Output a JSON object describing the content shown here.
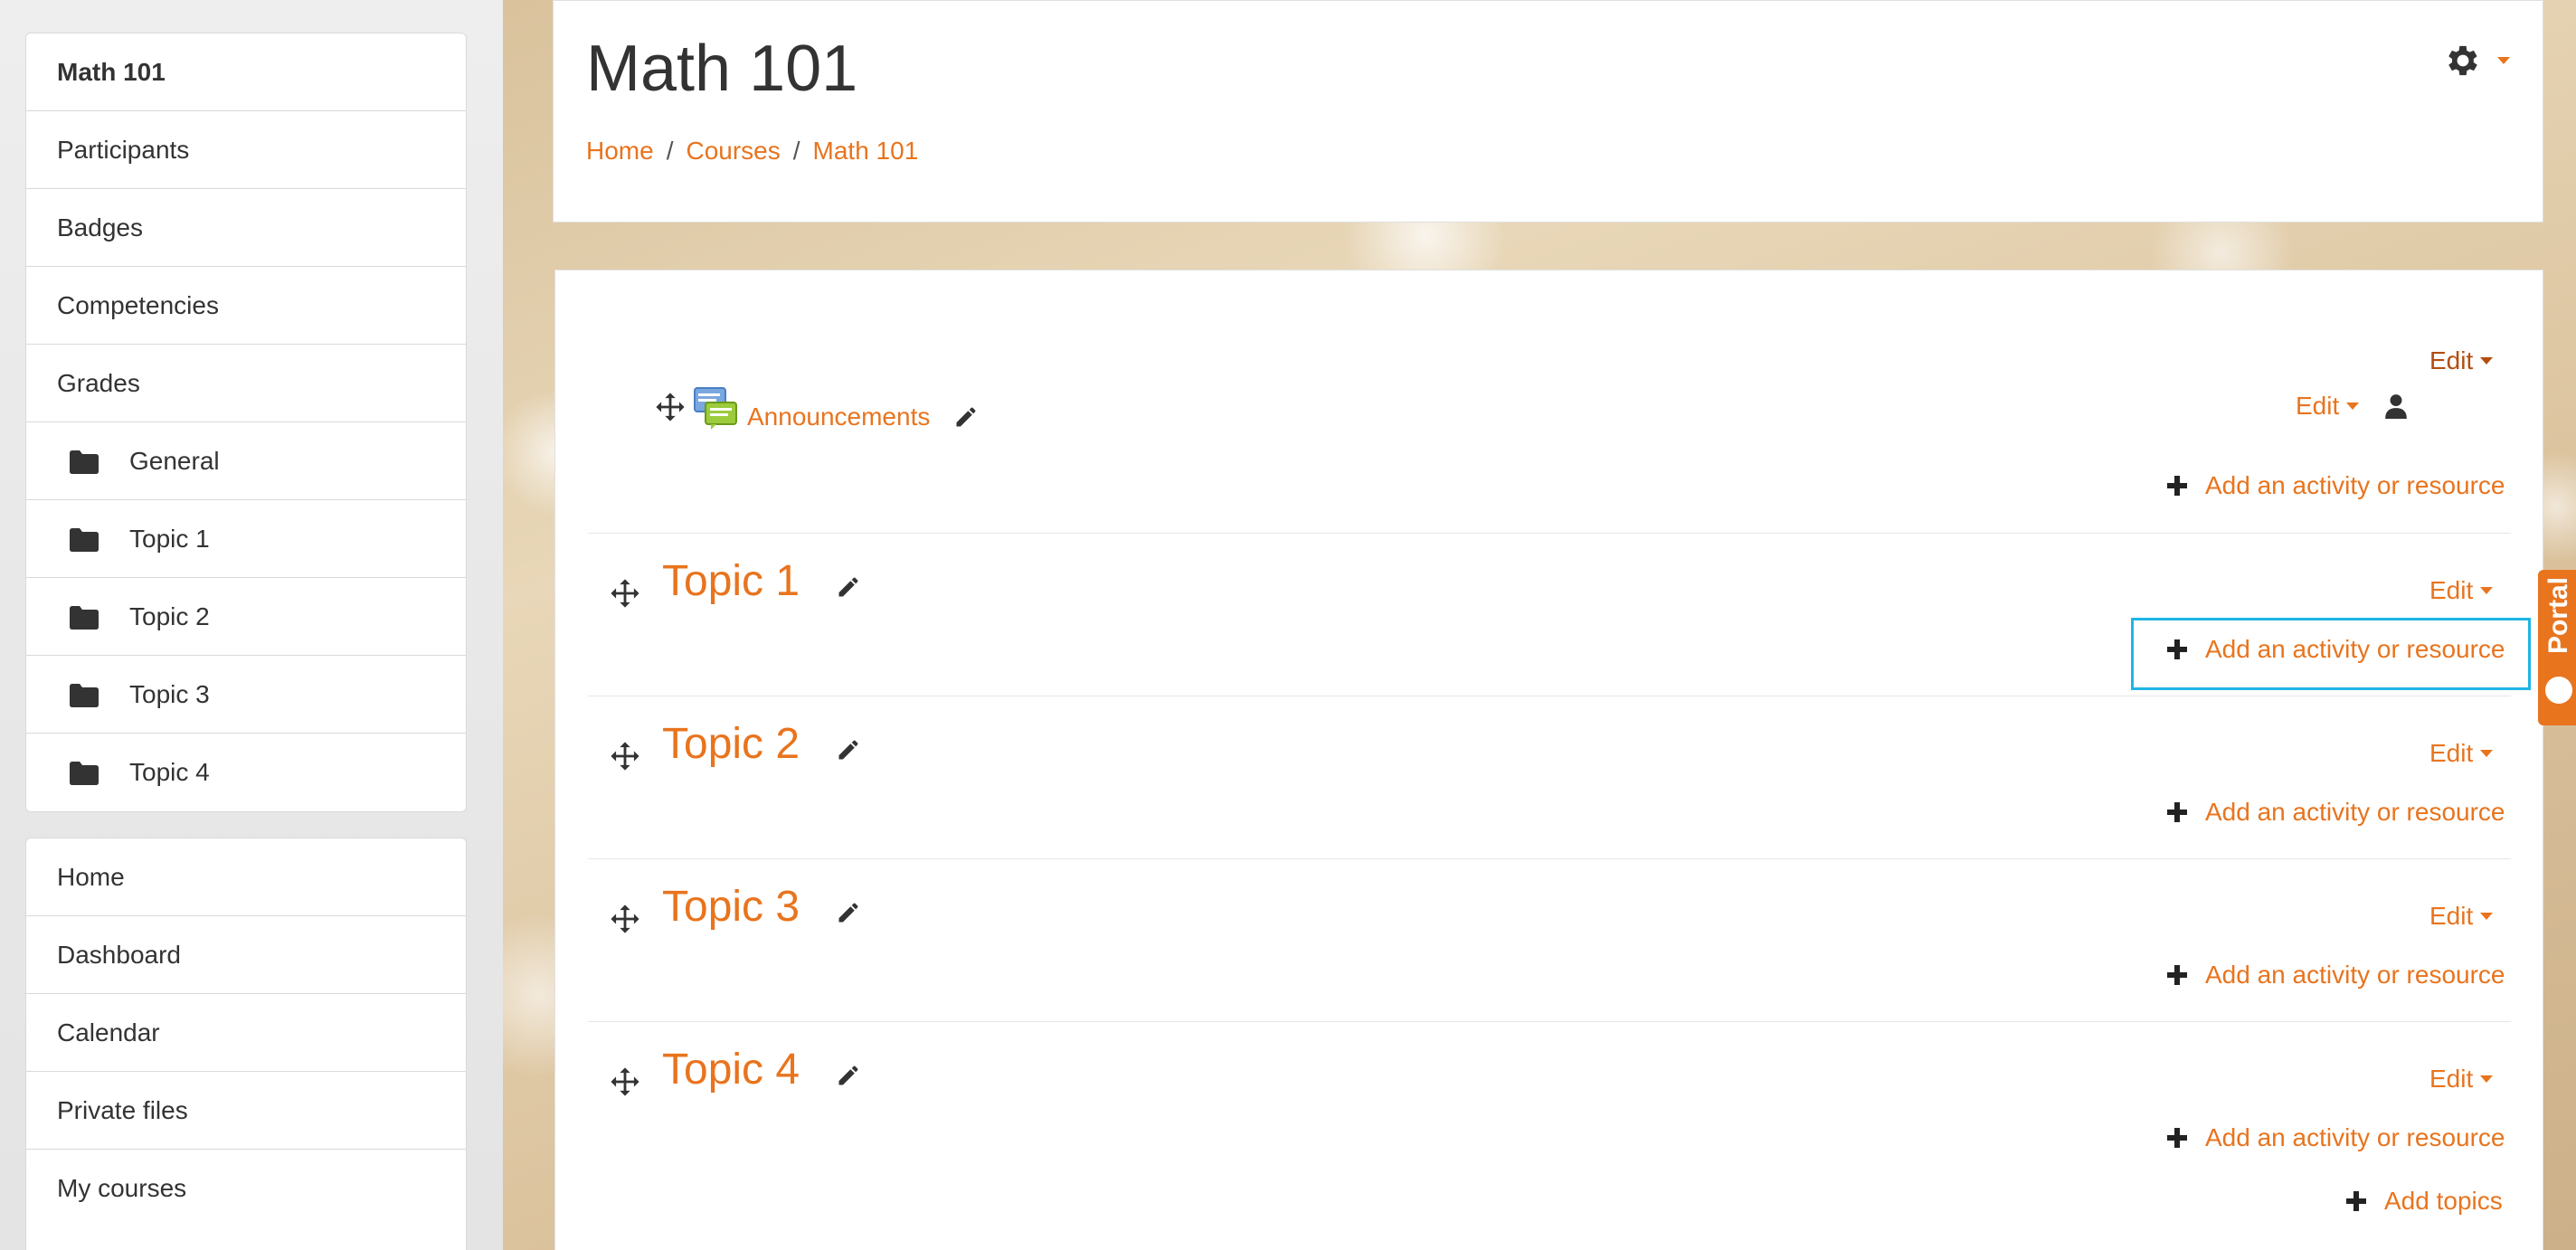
{
  "course_nav": {
    "items": [
      {
        "label": "Math 101",
        "bold": true
      },
      {
        "label": "Participants"
      },
      {
        "label": "Badges"
      },
      {
        "label": "Competencies"
      },
      {
        "label": "Grades"
      },
      {
        "label": "General",
        "icon": "folder-icon"
      },
      {
        "label": "Topic 1",
        "icon": "folder-icon"
      },
      {
        "label": "Topic 2",
        "icon": "folder-icon"
      },
      {
        "label": "Topic 3",
        "icon": "folder-icon"
      },
      {
        "label": "Topic 4",
        "icon": "folder-icon"
      }
    ]
  },
  "site_nav": {
    "items": [
      {
        "label": "Home"
      },
      {
        "label": "Dashboard"
      },
      {
        "label": "Calendar"
      },
      {
        "label": "Private files"
      },
      {
        "label": "My courses"
      }
    ]
  },
  "header": {
    "title": "Math 101",
    "breadcrumb": [
      "Home",
      "Courses",
      "Math 101"
    ],
    "breadcrumb_sep": "/",
    "settings_icon": "gear-icon"
  },
  "general_section": {
    "edit_label": "Edit",
    "activity": {
      "name": "Announcements",
      "icon": "forum-icon",
      "edit_label": "Edit"
    },
    "add_label": "Add an activity or resource"
  },
  "sections": [
    {
      "title": "Topic 1",
      "edit_label": "Edit",
      "add_label": "Add an activity or resource"
    },
    {
      "title": "Topic 2",
      "edit_label": "Edit",
      "add_label": "Add an activity or resource"
    },
    {
      "title": "Topic 3",
      "edit_label": "Edit",
      "add_label": "Add an activity or resource"
    },
    {
      "title": "Topic 4",
      "edit_label": "Edit",
      "add_label": "Add an activity or resource"
    }
  ],
  "add_topics_label": "Add topics",
  "portal_tab": {
    "label": "Portal"
  },
  "colors": {
    "accent": "#e8741e",
    "highlight": "#1fb5e6",
    "text": "#333333"
  }
}
